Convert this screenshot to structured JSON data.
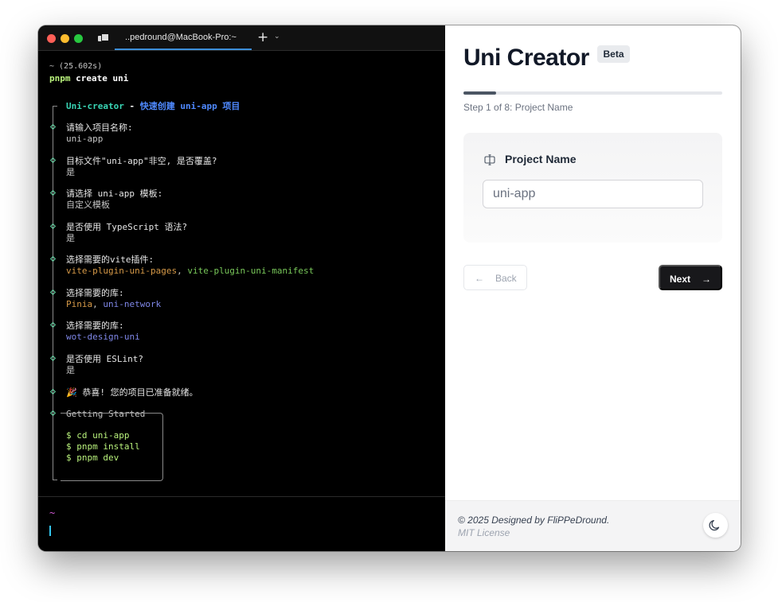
{
  "terminal": {
    "tab_title": "..pedround@MacBook-Pro:~",
    "new_tab": "+",
    "tab_menu": "⌄",
    "timing": "~ (25.602s)",
    "command_pnpm": "pnpm",
    "command_rest": " create uni",
    "header_name": "Uni-creator",
    "header_sep": " - ",
    "header_desc": "快速创建 uni-app 项目",
    "q1": "请输入项目名称:",
    "a1": "uni-app",
    "q2": "目标文件\"uni-app\"非空, 是否覆盖?",
    "a2": "是",
    "q3": "请选择 uni-app 模板:",
    "a3": "自定义模板",
    "q4": "是否使用 TypeScript 语法?",
    "a4": "是",
    "q5": "选择需要的vite插件:",
    "a5_1": "vite-plugin-uni-pages",
    "a5_sep": ", ",
    "a5_2": "vite-plugin-uni-manifest",
    "q6": "选择需要的库:",
    "a6_1": "Pinia",
    "a6_sep": ", ",
    "a6_2": "uni-network",
    "q7": "选择需要的库:",
    "a7": "wot-design-uni",
    "q8": "是否使用 ESLint?",
    "a8": "是",
    "done_emoji": "🎉",
    "done": "恭喜! 您的项目已准备就绪。",
    "getting_started": "Getting Started",
    "cmd1": "$ cd uni-app",
    "cmd2": "$ pnpm install",
    "cmd3": "$ pnpm dev",
    "prompt_tilde": "~"
  },
  "app": {
    "title": "Uni Creator",
    "badge": "Beta",
    "progress_fraction": 0.125,
    "step_text": "Step 1 of 8: Project Name",
    "field_label": "Project Name",
    "field_value": "uni-app",
    "back_arrow": "←",
    "back_label": "Back",
    "next_label": "Next",
    "next_arrow": "→",
    "footer_main": "© 2025 Designed by FliPPeDround.",
    "footer_sub": "MIT License",
    "theme_icon": "moon-icon"
  },
  "colors": {
    "accent_green": "#b9f27c",
    "accent_teal": "#39d5b5",
    "accent_blue": "#4f89ff",
    "orange": "#d79a48",
    "button_dark": "#18181b"
  }
}
